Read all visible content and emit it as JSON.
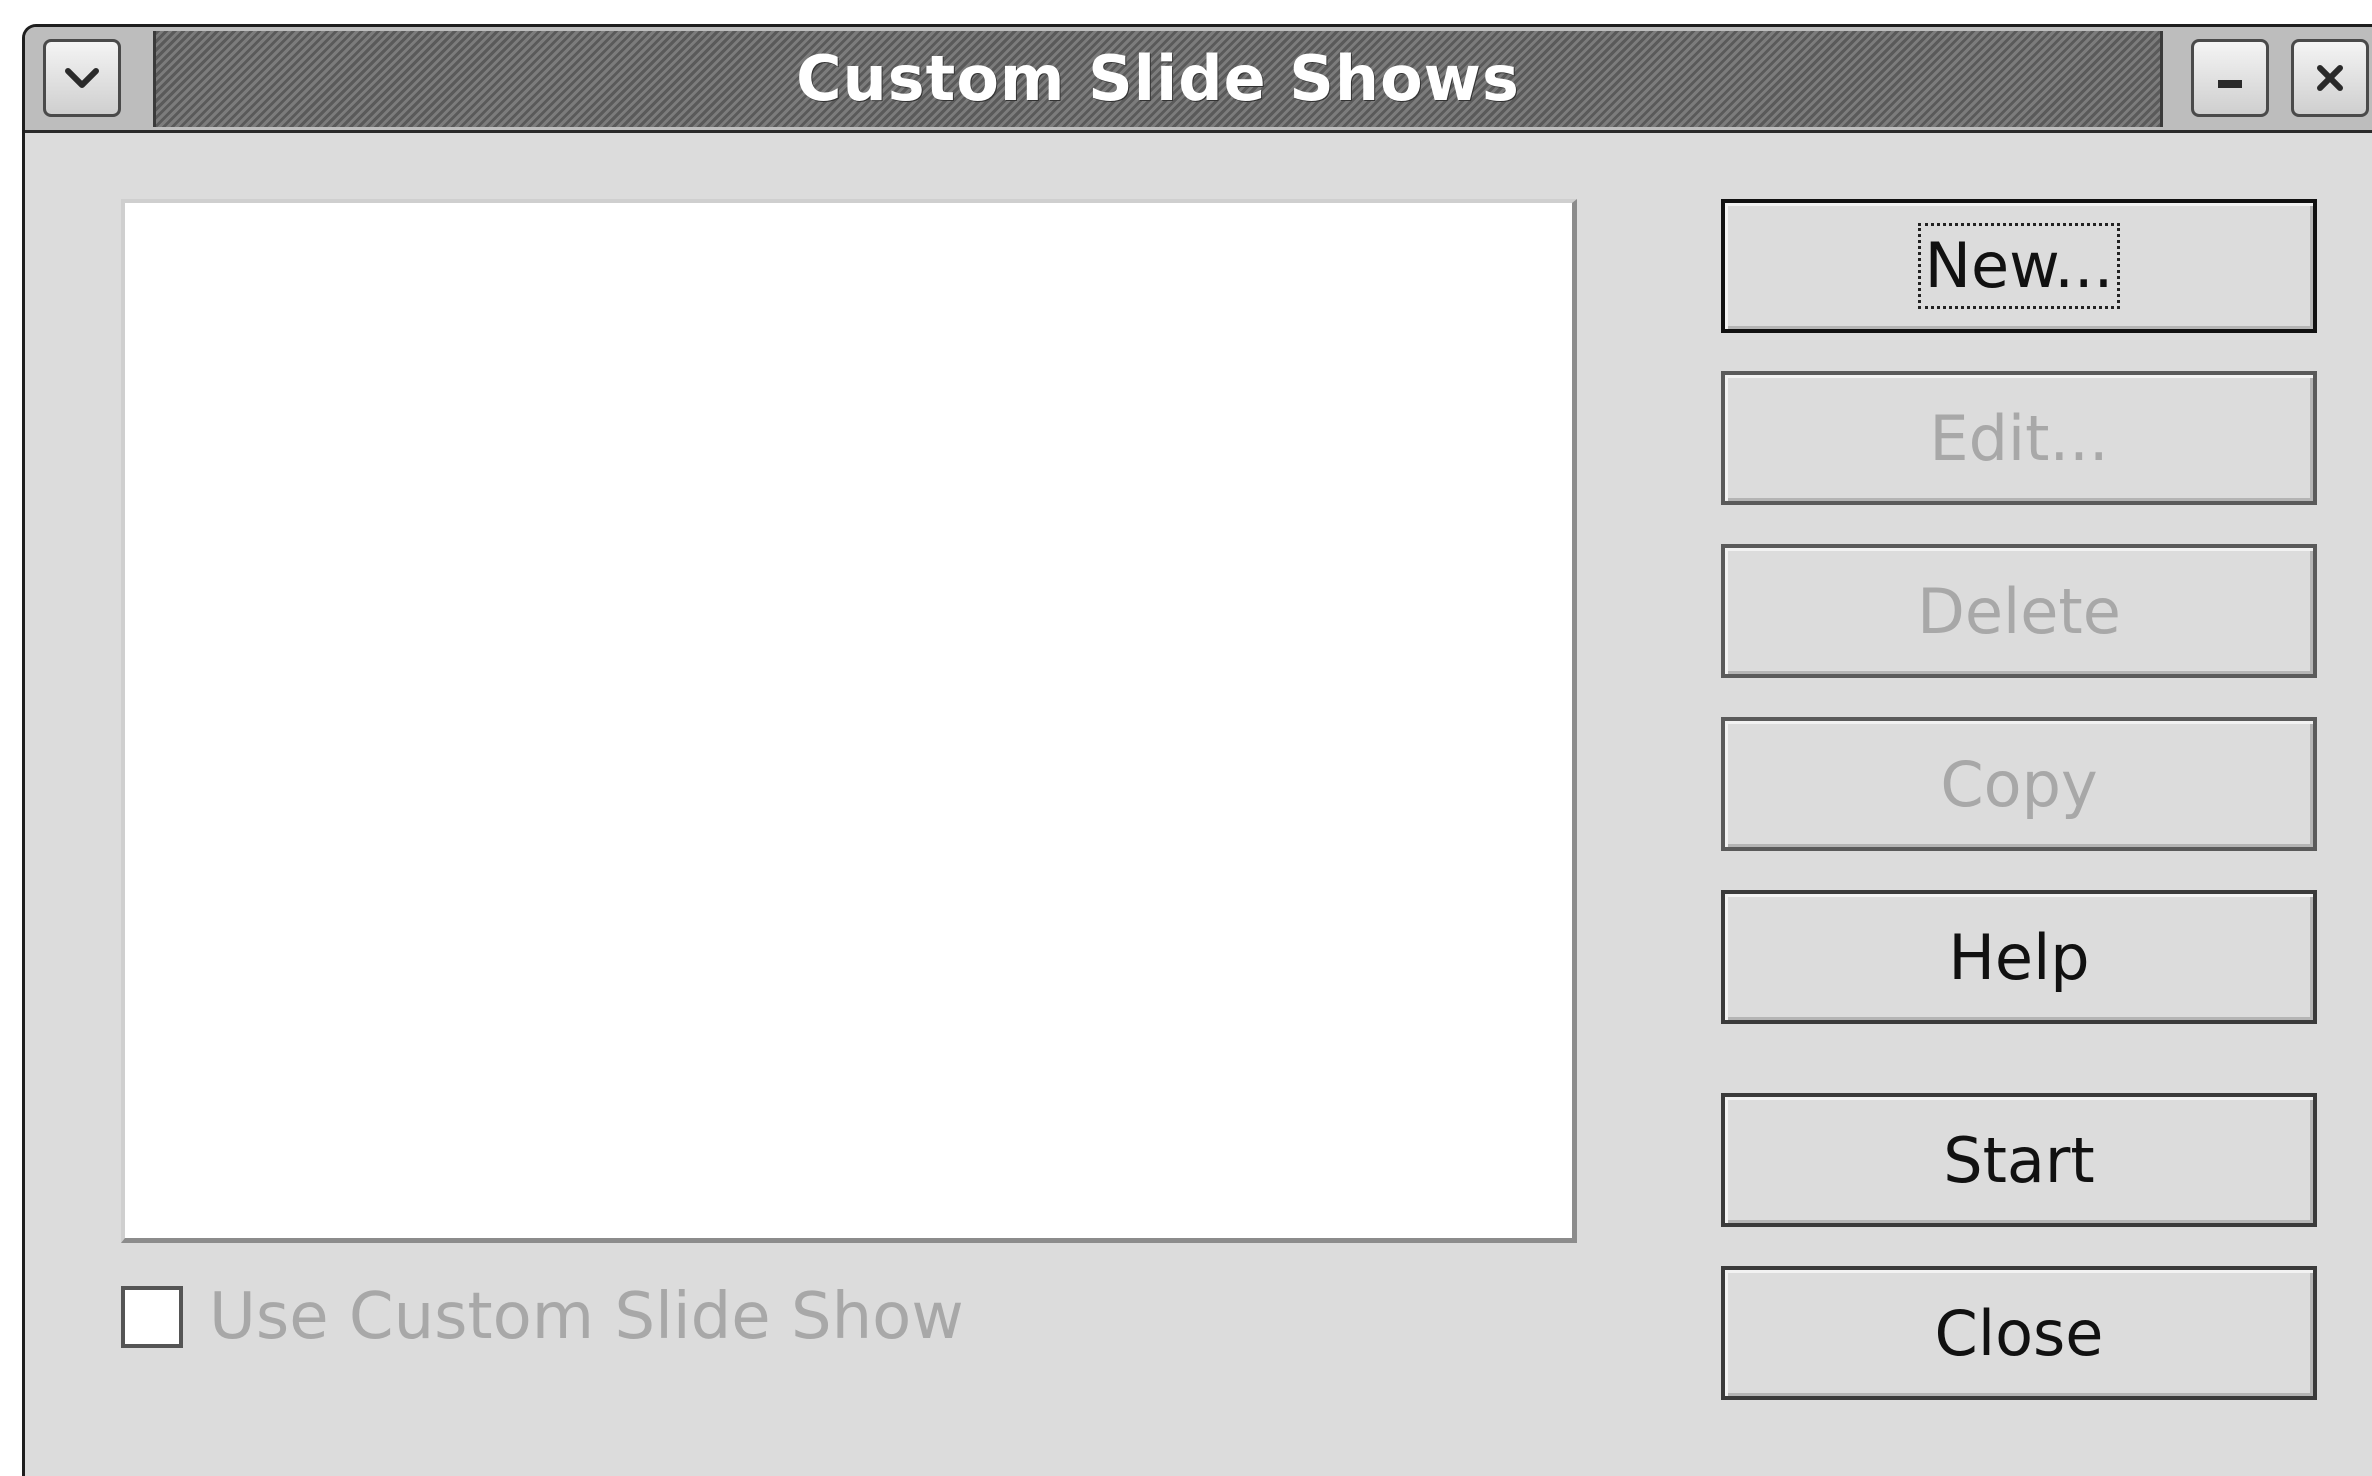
{
  "dialog": {
    "title": "Custom Slide Shows"
  },
  "custom_show_list": {
    "items": []
  },
  "use_custom_show": {
    "label": "Use Custom Slide Show",
    "checked": false,
    "enabled": false
  },
  "buttons": {
    "new": {
      "label": "New...",
      "enabled": true,
      "focused": true
    },
    "edit": {
      "label": "Edit...",
      "enabled": false
    },
    "delete": {
      "label": "Delete",
      "enabled": false
    },
    "copy": {
      "label": "Copy",
      "enabled": false
    },
    "help": {
      "label": "Help",
      "enabled": true
    },
    "start": {
      "label": "Start",
      "enabled": true
    },
    "close": {
      "label": "Close",
      "enabled": true
    }
  },
  "icons": {
    "window_menu": "chevron-down-icon",
    "minimize": "minimize-icon",
    "close": "close-icon"
  },
  "colors": {
    "dialog_bg": "#dcdcdc",
    "titlebar_stripe": "#666666",
    "disabled_text": "#a8a8a8",
    "list_bg": "#ffffff"
  }
}
